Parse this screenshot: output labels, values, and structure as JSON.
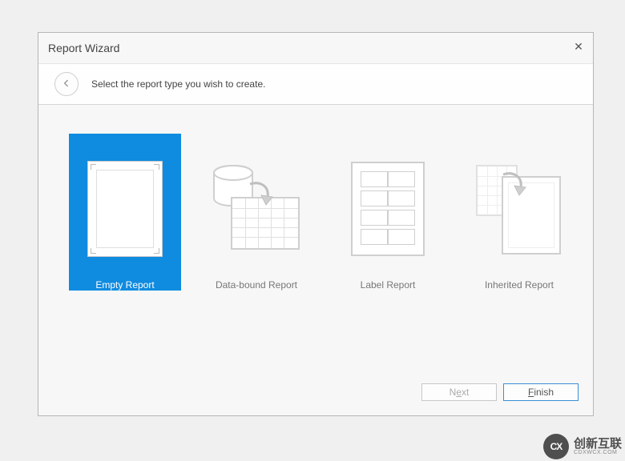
{
  "dialog": {
    "title": "Report Wizard",
    "close_glyph": "✕",
    "instruction": "Select the report type you wish to create."
  },
  "options": [
    {
      "id": "empty",
      "label": "Empty Report",
      "selected": true
    },
    {
      "id": "databound",
      "label": "Data-bound Report",
      "selected": false
    },
    {
      "id": "label",
      "label": "Label Report",
      "selected": false
    },
    {
      "id": "inherited",
      "label": "Inherited Report",
      "selected": false
    }
  ],
  "footer": {
    "next_label_pre": "N",
    "next_label_ul": "e",
    "next_label_post": "xt",
    "next_enabled": false,
    "finish_label_ul": "F",
    "finish_label_post": "inish",
    "finish_enabled": true
  },
  "watermark": {
    "logo_text": "CX",
    "main": "创新互联",
    "sub": "CDXWCX.COM"
  }
}
